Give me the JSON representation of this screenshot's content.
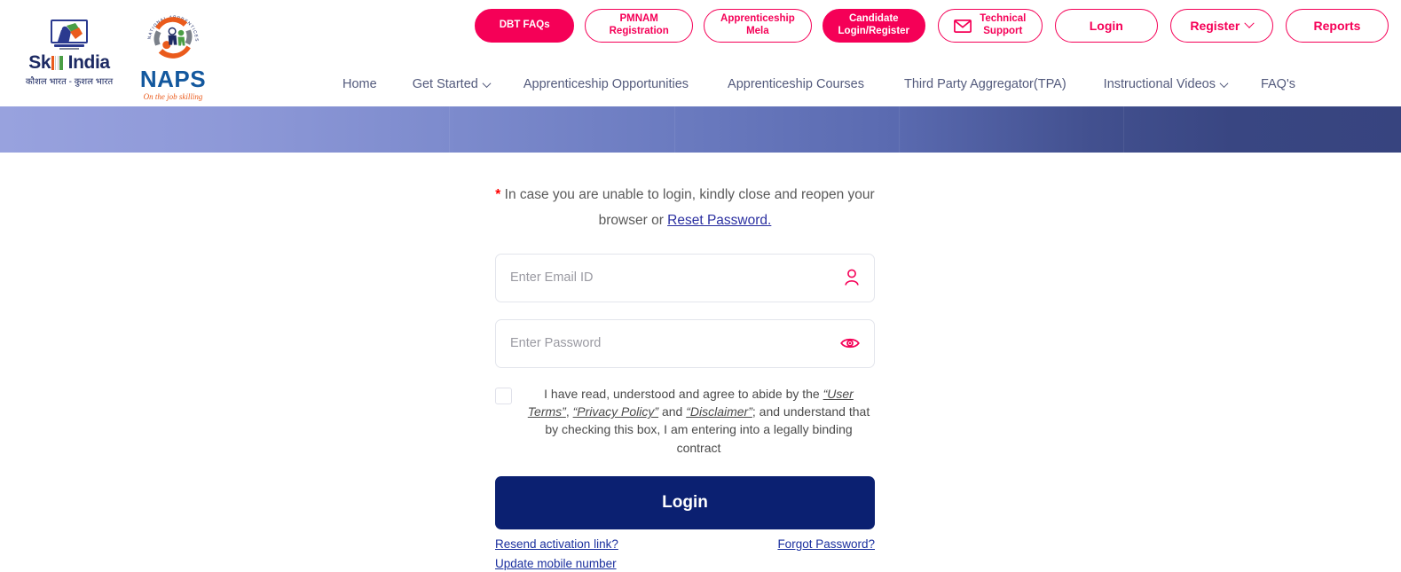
{
  "header": {
    "logos": {
      "skill_india": {
        "name": "skill-india-logo",
        "word_pre": "Sk",
        "word_post": " India",
        "subtitle": "कौशल भारत - कुशल भारत"
      },
      "naps": {
        "name": "naps-logo",
        "word": "NAPS",
        "tagline": "On the job skilling",
        "ring_text": "NATIONAL APPRENTICESHIP PROMOTION SCHEME"
      }
    },
    "top_buttons": [
      {
        "label": "DBT FAQs",
        "style": "solid",
        "icon": null,
        "chevron": false
      },
      {
        "label": "PMNAM\nRegistration",
        "line1": "PMNAM",
        "line2": "Registration",
        "style": "ghost",
        "icon": null,
        "chevron": false
      },
      {
        "label": "Apprenticeship\nMela",
        "line1": "Apprenticeship",
        "line2": "Mela",
        "style": "ghost",
        "icon": null,
        "chevron": false
      },
      {
        "label": "Candidate\nLogin/Register",
        "line1": "Candidate",
        "line2": "Login/Register",
        "style": "solid",
        "icon": null,
        "chevron": false
      },
      {
        "label": "Technical\nSupport",
        "line1": "Technical",
        "line2": "Support",
        "style": "ghost",
        "icon": "mail-icon",
        "chevron": false
      },
      {
        "label": "Login",
        "style": "ghost",
        "icon": null,
        "chevron": false
      },
      {
        "label": "Register",
        "style": "ghost",
        "icon": null,
        "chevron": true
      },
      {
        "label": "Reports",
        "style": "ghost",
        "icon": null,
        "chevron": false
      }
    ],
    "nav_items": [
      {
        "label": "Home",
        "chevron": false
      },
      {
        "label": "Get Started",
        "chevron": true
      },
      {
        "label": "Apprenticeship Opportunities",
        "chevron": false
      },
      {
        "label": "Apprenticeship Courses",
        "chevron": false
      },
      {
        "label": "Third Party Aggregator(TPA)",
        "chevron": false
      },
      {
        "label": "Instructional Videos",
        "chevron": true
      },
      {
        "label": "FAQ's",
        "chevron": false
      }
    ]
  },
  "login": {
    "notice": {
      "star": "*",
      "text_before": " In case you are unable to login, kindly close and reopen your browser or ",
      "link": "Reset Password."
    },
    "email": {
      "value": "",
      "placeholder": "Enter Email ID",
      "icon": "user-icon"
    },
    "password": {
      "value": "",
      "placeholder": "Enter Password",
      "icon": "eye-icon"
    },
    "terms": {
      "checked": false,
      "p1": "I have read, understood and agree to abide by the ",
      "t1": "“User Terms”",
      "p2": ", ",
      "t2": "“Privacy Policy”",
      "p3": " and ",
      "t3": "“Disclaimer”",
      "p4": "; and understand that by checking this box, I am entering into a legally binding contract"
    },
    "submit_label": "Login",
    "resend_link": "Resend activation link?",
    "forgot_link": "Forgot Password?",
    "update_mobile_link": "Update mobile number"
  },
  "colors": {
    "pink": "#f50057",
    "navy": "#0b2071",
    "link_blue": "#1a2f9e",
    "nav_text": "#535a7c",
    "banner_from": "#98a2de",
    "banner_to": "#37447f"
  }
}
